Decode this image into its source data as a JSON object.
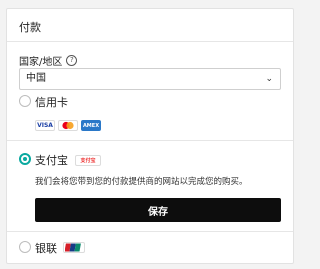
{
  "section_title": "付款",
  "country": {
    "label": "国家/地区",
    "help_icon": "question-circle-icon",
    "selected": "中国",
    "chevron_icon": "chevron-down-icon"
  },
  "payment_options": {
    "credit_card": {
      "label": "信用卡",
      "logos": [
        "VISA",
        "mastercard",
        "AMEX"
      ]
    },
    "alipay": {
      "label": "支付宝",
      "logo": "支付宝",
      "note": "我们会将您带到您的付款提供商的网站以完成您的购买。",
      "button": "保存"
    },
    "unionpay": {
      "label": "银联",
      "logo": "UnionPay"
    }
  },
  "colors": {
    "accent": "#0aa9a0",
    "button": "#0d0d0d"
  }
}
